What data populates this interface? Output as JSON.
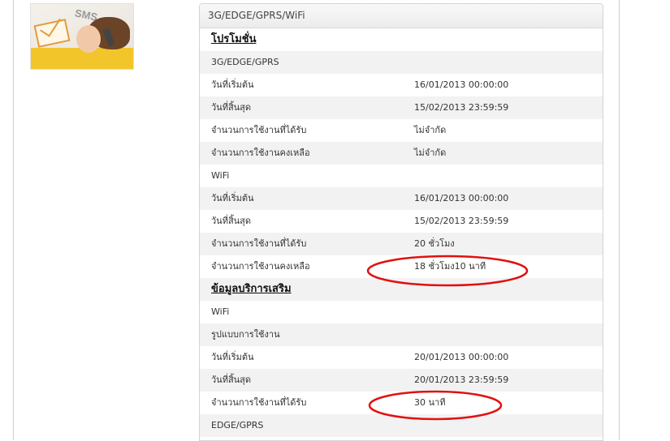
{
  "promo_image": {
    "icon_text": "SMS"
  },
  "panel": {
    "title": "3G/EDGE/GPRS/WiFi",
    "rows": [
      {
        "type": "section",
        "label": "โปรโมชั่น"
      },
      {
        "type": "group",
        "label": "3G/EDGE/GPRS"
      },
      {
        "type": "field",
        "label": "วันที่เริ่มต้น",
        "value": "16/01/2013 00:00:00"
      },
      {
        "type": "field",
        "label": "วันที่สิ้นสุด",
        "value": "15/02/2013 23:59:59"
      },
      {
        "type": "field",
        "label": "จำนวนการใช้งานที่ได้รับ",
        "value": "ไม่จำกัด"
      },
      {
        "type": "field",
        "label": "จำนวนการใช้งานคงเหลือ",
        "value": "ไม่จำกัด"
      },
      {
        "type": "group",
        "label": "WiFi"
      },
      {
        "type": "field",
        "label": "วันที่เริ่มต้น",
        "value": "16/01/2013 00:00:00"
      },
      {
        "type": "field",
        "label": "วันที่สิ้นสุด",
        "value": "15/02/2013 23:59:59"
      },
      {
        "type": "field",
        "label": "จำนวนการใช้งานที่ได้รับ",
        "value": "20 ชั่วโมง"
      },
      {
        "type": "field",
        "label": "จำนวนการใช้งานคงเหลือ",
        "value": "18 ชั่วโมง10 นาที"
      },
      {
        "type": "section",
        "label": "ข้อมูลบริการเสริม"
      },
      {
        "type": "group",
        "label": "WiFi"
      },
      {
        "type": "group",
        "label": "รูปแบบการใช้งาน"
      },
      {
        "type": "field",
        "label": "วันที่เริ่มต้น",
        "value": "20/01/2013 00:00:00"
      },
      {
        "type": "field",
        "label": "วันที่สิ้นสุด",
        "value": "20/01/2013 23:59:59"
      },
      {
        "type": "field",
        "label": "จำนวนการใช้งานที่ได้รับ",
        "value": "30 นาที"
      },
      {
        "type": "group",
        "label": "EDGE/GPRS"
      }
    ]
  },
  "colors": {
    "annotation": "#e01010",
    "row_alt": "#f2f2f2",
    "border": "#d4d4d4"
  }
}
